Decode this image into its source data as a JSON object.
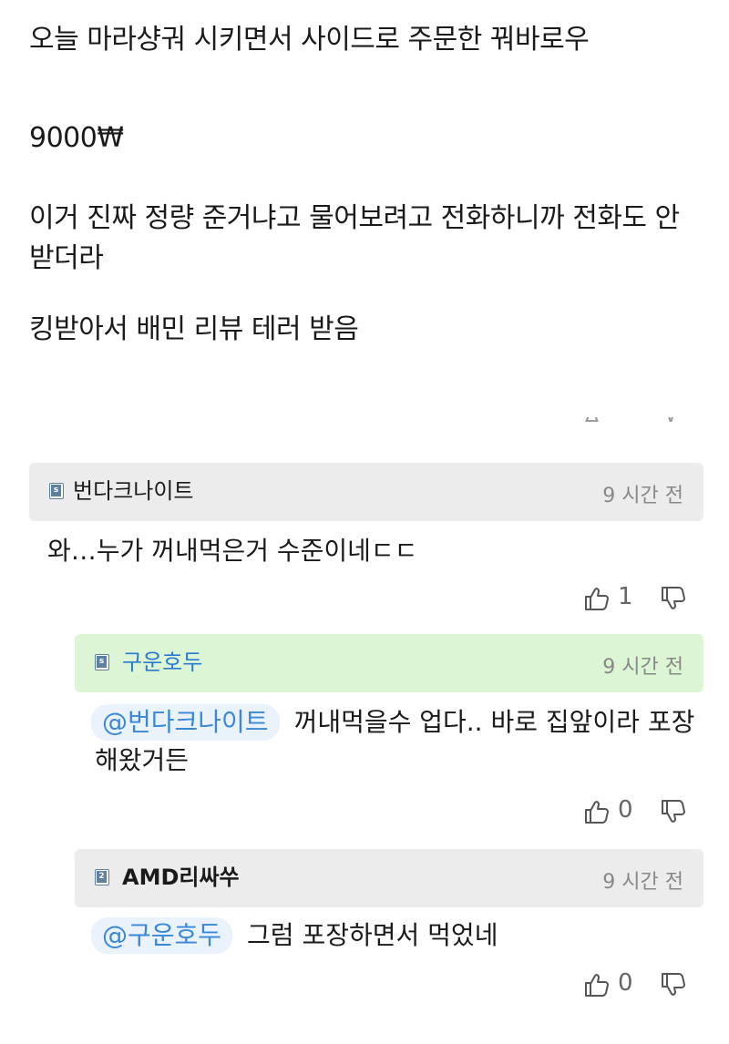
{
  "post": {
    "line1": "오늘 마라샹궈 시키면서 사이드로 주문한 꿔바로우",
    "line2": "9000₩",
    "line3": "이거 진짜 정량 준거냐고 물어보려고 전화하니까 전화도 안받더라",
    "line4": "킹받아서 배민 리뷰 테러 받음"
  },
  "comments": [
    {
      "author": "번다크나이트",
      "badge": "s",
      "time": "9 시간 전",
      "mention": "",
      "text": "와…누가 꺼내먹은거 수준이네ㄷㄷ",
      "likes": "1",
      "header_color": "#ececec"
    },
    {
      "author": "구운호두",
      "badge": "s",
      "time": "9 시간 전",
      "mention": "@번다크나이트",
      "text": "꺼내먹을수 업다.. 바로 집앞이라 포장해왔거든",
      "likes": "0",
      "header_color": "#dbf5d5",
      "author_color": "#2a7bd0"
    },
    {
      "author": "AMD리싸쑤",
      "badge": "2",
      "time": "9 시간 전",
      "mention": "@구운호두",
      "text": "그럼 포장하면서 먹었네",
      "likes": "0",
      "header_color": "#ececec"
    }
  ],
  "icons": [
    "thumbs-up-icon",
    "thumbs-down-icon",
    "level-badge-icon"
  ]
}
